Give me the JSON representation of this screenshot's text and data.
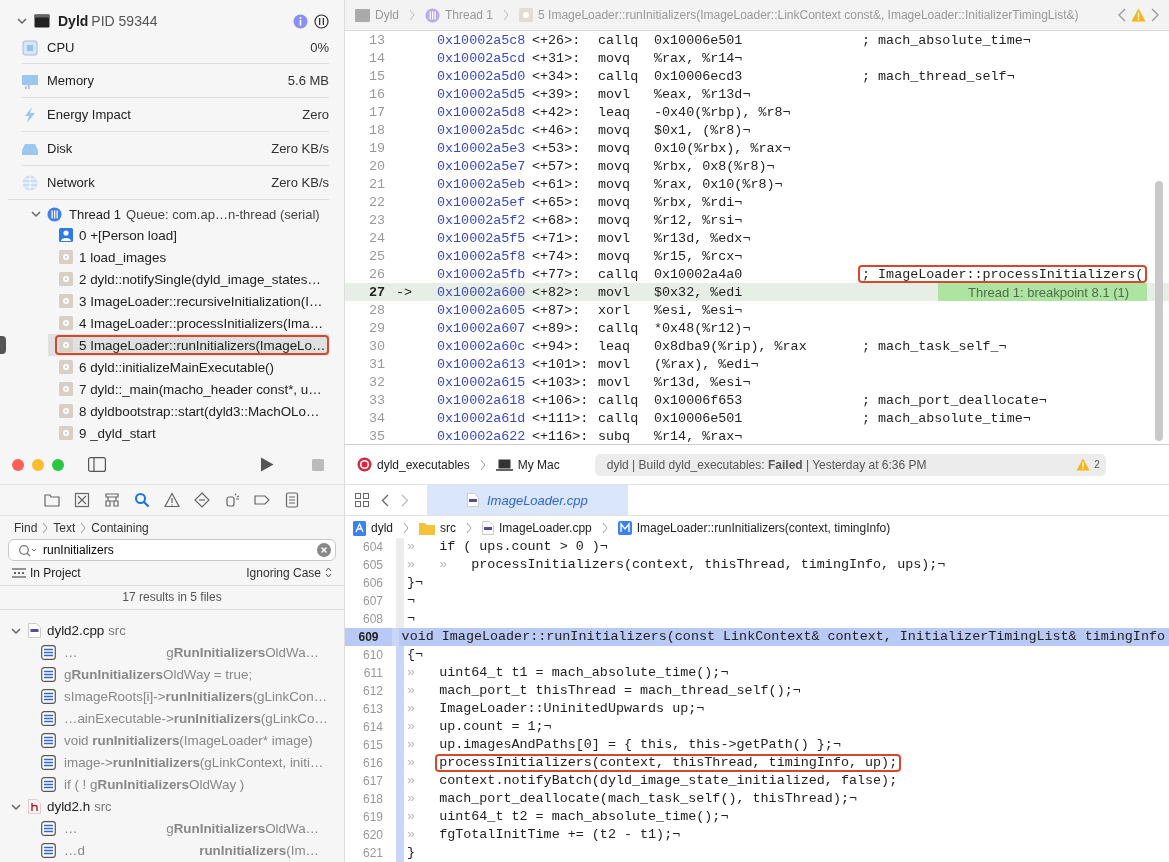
{
  "debug_navigator": {
    "process": {
      "name": "Dyld",
      "pid": "PID 59344",
      "expanded": true
    },
    "gauges": [
      {
        "kind": "cpu",
        "label": "CPU",
        "value": "0%"
      },
      {
        "kind": "memory",
        "label": "Memory",
        "value": "5.6 MB"
      },
      {
        "kind": "energy",
        "label": "Energy Impact",
        "value": "Zero"
      },
      {
        "kind": "disk",
        "label": "Disk",
        "value": "Zero KB/s"
      },
      {
        "kind": "network",
        "label": "Network",
        "value": "Zero KB/s"
      }
    ],
    "thread": {
      "name": "Thread 1",
      "queue": "Queue: com.ap…n-thread (serial)",
      "expanded": true,
      "frames": [
        {
          "label": "0 +[Person load]",
          "kind": "user",
          "selected": false,
          "outlined": false
        },
        {
          "label": "1 load_images",
          "kind": "system",
          "selected": false,
          "outlined": false
        },
        {
          "label": "2 dyld::notifySingle(dyld_image_states…",
          "kind": "system",
          "selected": false,
          "outlined": false
        },
        {
          "label": "3 ImageLoader::recursiveInitialization(I…",
          "kind": "system",
          "selected": false,
          "outlined": false
        },
        {
          "label": "4 ImageLoader::processInitializers(Ima…",
          "kind": "system",
          "selected": false,
          "outlined": false
        },
        {
          "label": "5 ImageLoader::runInitializers(ImageLo…",
          "kind": "system",
          "selected": true,
          "outlined": true
        },
        {
          "label": "6 dyld::initializeMainExecutable()",
          "kind": "system",
          "selected": false,
          "outlined": false
        },
        {
          "label": "7 dyld::_main(macho_header const*, u…",
          "kind": "system",
          "selected": false,
          "outlined": false
        },
        {
          "label": "8 dyldbootstrap::start(dyld3::MachOLo…",
          "kind": "system",
          "selected": false,
          "outlined": false
        },
        {
          "label": "9 _dyld_start",
          "kind": "system",
          "selected": false,
          "outlined": false
        }
      ]
    }
  },
  "disassembly": {
    "jump_bar": [
      {
        "kind": "app",
        "label": "Dyld"
      },
      {
        "kind": "thread",
        "label": "Thread 1"
      },
      {
        "kind": "frame",
        "label": "5 ImageLoader::runInitializers(ImageLoader::LinkContext const&, ImageLoader::InitializerTimingList&)"
      }
    ],
    "lines": [
      {
        "n": "13",
        "addr": "0x10002a5c8",
        "off": "<+26>:",
        "op": "callq",
        "args": "0x10006e501",
        "comment": "; mach_absolute_time¬",
        "current": false,
        "outlined": false
      },
      {
        "n": "14",
        "addr": "0x10002a5cd",
        "off": "<+31>:",
        "op": "movq",
        "args": "%rax, %r14¬",
        "current": false,
        "outlined": false
      },
      {
        "n": "15",
        "addr": "0x10002a5d0",
        "off": "<+34>:",
        "op": "callq",
        "args": "0x10006ecd3",
        "comment": "; mach_thread_self¬",
        "current": false,
        "outlined": false
      },
      {
        "n": "16",
        "addr": "0x10002a5d5",
        "off": "<+39>:",
        "op": "movl",
        "args": "%eax, %r13d¬",
        "current": false,
        "outlined": false
      },
      {
        "n": "17",
        "addr": "0x10002a5d8",
        "off": "<+42>:",
        "op": "leaq",
        "args": "-0x40(%rbp), %r8¬",
        "current": false,
        "outlined": false
      },
      {
        "n": "18",
        "addr": "0x10002a5dc",
        "off": "<+46>:",
        "op": "movq",
        "args": "$0x1, (%r8)¬",
        "current": false,
        "outlined": false
      },
      {
        "n": "19",
        "addr": "0x10002a5e3",
        "off": "<+53>:",
        "op": "movq",
        "args": "0x10(%rbx), %rax¬",
        "current": false,
        "outlined": false
      },
      {
        "n": "20",
        "addr": "0x10002a5e7",
        "off": "<+57>:",
        "op": "movq",
        "args": "%rbx, 0x8(%r8)¬",
        "current": false,
        "outlined": false
      },
      {
        "n": "21",
        "addr": "0x10002a5eb",
        "off": "<+61>:",
        "op": "movq",
        "args": "%rax, 0x10(%r8)¬",
        "current": false,
        "outlined": false
      },
      {
        "n": "22",
        "addr": "0x10002a5ef",
        "off": "<+65>:",
        "op": "movq",
        "args": "%rbx, %rdi¬",
        "current": false,
        "outlined": false
      },
      {
        "n": "23",
        "addr": "0x10002a5f2",
        "off": "<+68>:",
        "op": "movq",
        "args": "%r12, %rsi¬",
        "current": false,
        "outlined": false
      },
      {
        "n": "24",
        "addr": "0x10002a5f5",
        "off": "<+71>:",
        "op": "movl",
        "args": "%r13d, %edx¬",
        "current": false,
        "outlined": false
      },
      {
        "n": "25",
        "addr": "0x10002a5f8",
        "off": "<+74>:",
        "op": "movq",
        "args": "%r15, %rcx¬",
        "current": false,
        "outlined": false
      },
      {
        "n": "26",
        "addr": "0x10002a5fb",
        "off": "<+77>:",
        "op": "callq",
        "args": "0x10002a4a0",
        "comment": "; ImageLoader::processInitializers(",
        "current": false,
        "outlined": true
      },
      {
        "n": "27",
        "marker": "->",
        "addr": "0x10002a600",
        "off": "<+82>:",
        "op": "movl",
        "args": "$0x32, %edi",
        "annotation": "Thread 1: breakpoint 8.1 (1)",
        "current": true,
        "outlined": false
      },
      {
        "n": "28",
        "addr": "0x10002a605",
        "off": "<+87>:",
        "op": "xorl",
        "args": "%esi, %esi¬",
        "current": false,
        "outlined": false
      },
      {
        "n": "29",
        "addr": "0x10002a607",
        "off": "<+89>:",
        "op": "callq",
        "args": "*0x48(%r12)¬",
        "current": false,
        "outlined": false
      },
      {
        "n": "30",
        "addr": "0x10002a60c",
        "off": "<+94>:",
        "op": "leaq",
        "args": "0x8dba9(%rip), %rax",
        "comment": "; mach_task_self_¬",
        "current": false,
        "outlined": false
      },
      {
        "n": "31",
        "addr": "0x10002a613",
        "off": "<+101>:",
        "op": "movl",
        "args": "(%rax), %edi¬",
        "current": false,
        "outlined": false
      },
      {
        "n": "32",
        "addr": "0x10002a615",
        "off": "<+103>:",
        "op": "movl",
        "args": "%r13d, %esi¬",
        "current": false,
        "outlined": false
      },
      {
        "n": "33",
        "addr": "0x10002a618",
        "off": "<+106>:",
        "op": "callq",
        "args": "0x10006f653",
        "comment": "; mach_port_deallocate¬",
        "current": false,
        "outlined": false
      },
      {
        "n": "34",
        "addr": "0x10002a61d",
        "off": "<+111>:",
        "op": "callq",
        "args": "0x10006e501",
        "comment": "; mach_absolute_time¬",
        "current": false,
        "outlined": false
      },
      {
        "n": "35",
        "addr": "0x10002a622",
        "off": "<+116>:",
        "op": "subq",
        "args": "%r14, %rax¬",
        "current": false,
        "outlined": false
      }
    ]
  },
  "find_navigator": {
    "navigator_tabs": [
      {
        "kind": "folder",
        "selected": false
      },
      {
        "kind": "source-control",
        "selected": false
      },
      {
        "kind": "hierarchy",
        "selected": false
      },
      {
        "kind": "search",
        "selected": true
      },
      {
        "kind": "warning",
        "selected": false
      },
      {
        "kind": "test",
        "selected": false
      },
      {
        "kind": "debug",
        "selected": false
      },
      {
        "kind": "breakpoint",
        "selected": false
      },
      {
        "kind": "report",
        "selected": false
      }
    ],
    "breadcrumb": [
      "Find",
      "Text",
      "Containing"
    ],
    "search": {
      "value": "runInitializers"
    },
    "scope": "In Project",
    "matching": "Ignoring Case",
    "summary": "17 results in 5 files",
    "files": [
      {
        "name": "dyld2.cpp",
        "dir": "src",
        "kind": "cpp",
        "expanded": true,
        "results": [
          {
            "lead": "…",
            "text": "g**RunInitializers**OldWa…"
          },
          {
            "text": "g**RunInitializers**OldWay = true;"
          },
          {
            "text": "sImageRoots[i]->**runInitializers**(gLinkCon…"
          },
          {
            "text": "…ainExecutable->**runInitializers**(gLinkCo…"
          },
          {
            "text": "void **runInitializers**(ImageLoader* image)"
          },
          {
            "text": "image->**runInitializers**(gLinkContext, initi…"
          },
          {
            "text": "if ( ! g**RunInitializers**OldWay )"
          }
        ]
      },
      {
        "name": "dyld2.h",
        "dir": "src",
        "kind": "h",
        "expanded": true,
        "results": [
          {
            "lead": "…",
            "text": "g**RunInitializers**OldWa…"
          },
          {
            "lead": "…d",
            "text": "**runInitializers**(Im…"
          }
        ]
      }
    ]
  },
  "toolbar": {
    "scheme": "dyld_executables",
    "destination": "My Mac",
    "status": "dyld | Build dyld_executables: **Failed** | Yesterday at 6:36 PM",
    "warnings": "2"
  },
  "editor": {
    "tabs": [
      {
        "label": "ImageLoader.cpp",
        "selected": true
      }
    ],
    "jump_bar": [
      {
        "kind": "project",
        "label": "dyld"
      },
      {
        "kind": "folder",
        "label": "src"
      },
      {
        "kind": "file",
        "label": "ImageLoader.cpp"
      },
      {
        "kind": "method",
        "label": "ImageLoader::runInitializers(context, timingInfo)"
      }
    ],
    "lines": [
      {
        "n": "604",
        "indent": "»   ",
        "code": "if ( ups.count > 0 )¬",
        "selected": false,
        "scope": false,
        "outlined": false
      },
      {
        "n": "605",
        "indent": "»   »   ",
        "code": "processInitializers(context, thisThread, timingInfo, ups);¬",
        "selected": false,
        "scope": false,
        "outlined": false
      },
      {
        "n": "606",
        "code": "}¬",
        "selected": false,
        "scope": false,
        "outlined": false
      },
      {
        "n": "607",
        "code": "¬",
        "selected": false,
        "scope": false,
        "outlined": false
      },
      {
        "n": "608",
        "code": "¬",
        "selected": false,
        "scope": false,
        "outlined": false
      },
      {
        "n": "609",
        "code": "void ImageLoader::runInitializers(const LinkContext& context, InitializerTimingList& timingInfo",
        "selected": true,
        "scope": true,
        "outlined": false
      },
      {
        "n": "610",
        "code": "{¬",
        "selected": false,
        "scope": true,
        "outlined": false
      },
      {
        "n": "611",
        "indent": "»   ",
        "code": "uint64_t t1 = mach_absolute_time();¬",
        "selected": false,
        "scope": true,
        "outlined": false
      },
      {
        "n": "612",
        "indent": "»   ",
        "code": "mach_port_t thisThread = mach_thread_self();¬",
        "selected": false,
        "scope": true,
        "outlined": false
      },
      {
        "n": "613",
        "indent": "»   ",
        "code": "ImageLoader::UninitedUpwards up;¬",
        "selected": false,
        "scope": true,
        "outlined": false
      },
      {
        "n": "614",
        "indent": "»   ",
        "code": "up.count = 1;¬",
        "selected": false,
        "scope": true,
        "outlined": false
      },
      {
        "n": "615",
        "indent": "»   ",
        "code": "up.imagesAndPaths[0] = { this, this->getPath() };¬",
        "selected": false,
        "scope": true,
        "outlined": false
      },
      {
        "n": "616",
        "indent": "»   ",
        "code": "processInitializers(context, thisThread, timingInfo, up);",
        "selected": false,
        "scope": true,
        "outlined": true
      },
      {
        "n": "617",
        "indent": "»   ",
        "code": "context.notifyBatch(dyld_image_state_initialized, false);",
        "selected": false,
        "scope": true,
        "outlined": false
      },
      {
        "n": "618",
        "indent": "»   ",
        "code": "mach_port_deallocate(mach_task_self(), thisThread);¬",
        "selected": false,
        "scope": true,
        "outlined": false
      },
      {
        "n": "619",
        "indent": "»   ",
        "code": "uint64_t t2 = mach_absolute_time();¬",
        "selected": false,
        "scope": true,
        "outlined": false
      },
      {
        "n": "620",
        "indent": "»   ",
        "code": "fgTotalInitTime += (t2 - t1);¬",
        "selected": false,
        "scope": true,
        "outlined": false
      },
      {
        "n": "621",
        "code": "}",
        "selected": false,
        "scope": true,
        "outlined": false
      }
    ]
  }
}
